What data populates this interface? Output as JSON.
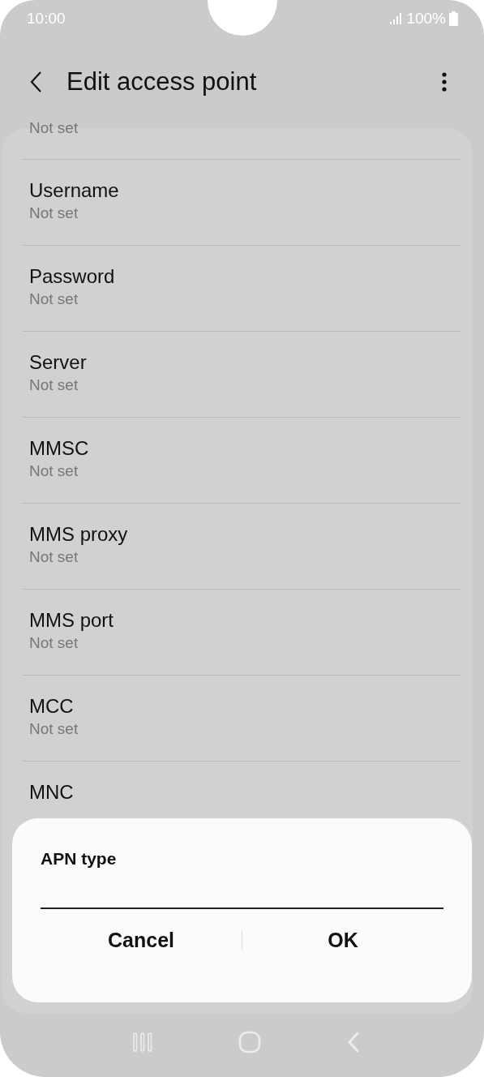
{
  "status_bar": {
    "time": "10:00",
    "battery": "100%"
  },
  "app_bar": {
    "title": "Edit access point"
  },
  "settings": [
    {
      "kind": "partial",
      "value": "Not set"
    },
    {
      "kind": "row",
      "title": "Username",
      "value": "Not set"
    },
    {
      "kind": "row",
      "title": "Password",
      "value": "Not set"
    },
    {
      "kind": "row",
      "title": "Server",
      "value": "Not set"
    },
    {
      "kind": "row",
      "title": "MMSC",
      "value": "Not set"
    },
    {
      "kind": "row",
      "title": "MMS proxy",
      "value": "Not set"
    },
    {
      "kind": "row",
      "title": "MMS port",
      "value": "Not set"
    },
    {
      "kind": "row",
      "title": "MCC",
      "value": "Not set"
    },
    {
      "kind": "row",
      "title": "MNC"
    }
  ],
  "dialog": {
    "title": "APN type",
    "buttons": [
      "Cancel",
      "OK"
    ]
  }
}
